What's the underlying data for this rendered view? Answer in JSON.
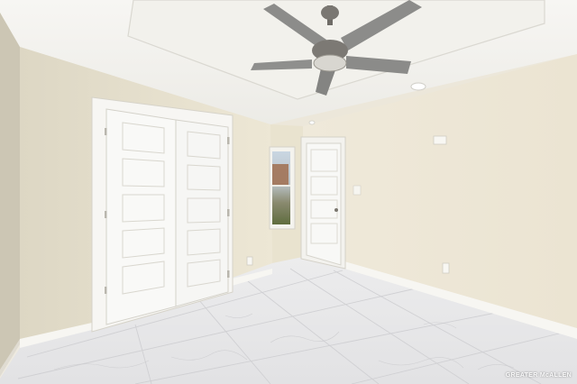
{
  "photo": {
    "colors": {
      "wall_left": "#ebe5d2",
      "wall_right": "#eee8d8",
      "ceiling": "#f4f2ed",
      "floor": "#e9e9ea",
      "door": "#f8f8f6",
      "trim": "#f6f5f1",
      "fan_metal": "#6f6c67"
    },
    "watermark": "GREATER McALLEN"
  }
}
